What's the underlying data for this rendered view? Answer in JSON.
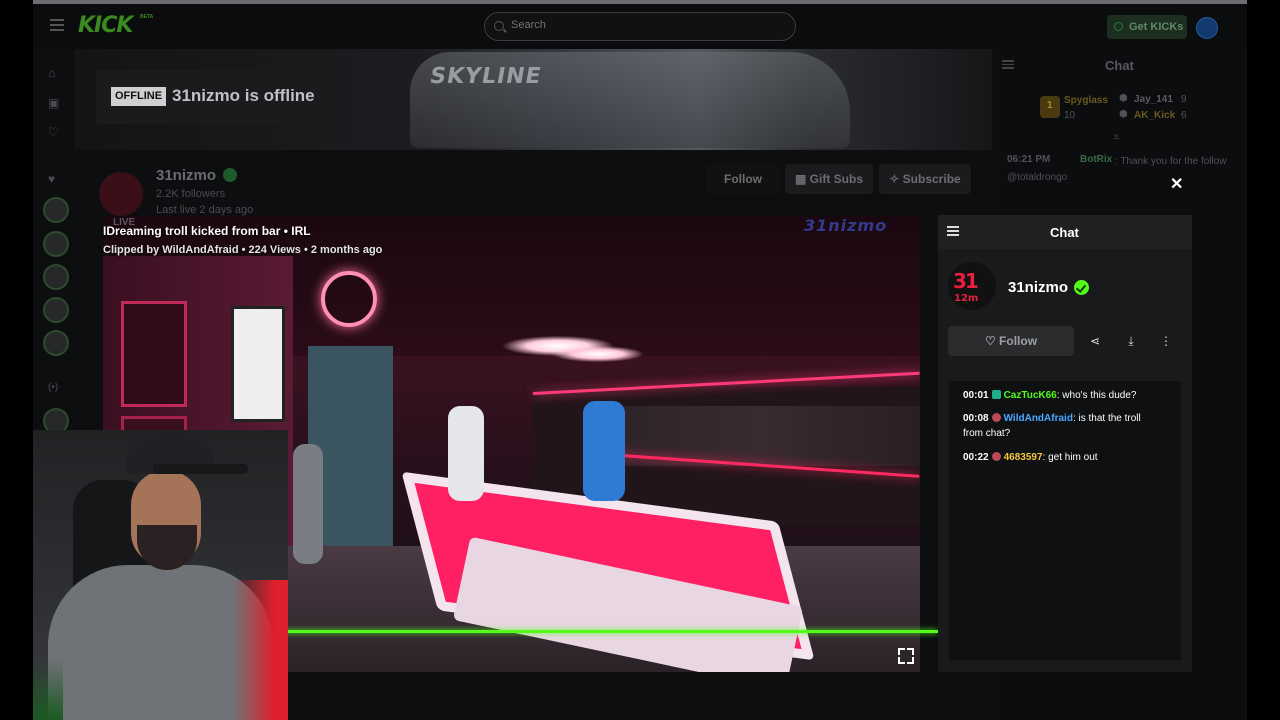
{
  "topnav": {
    "logo": "KICK",
    "logo_badge": "BETA",
    "search_placeholder": "Search",
    "get_kicks": "Get KICKs"
  },
  "banner": {
    "offline_badge": "OFFLINE",
    "offline_text": "31nizmo is offline",
    "car_text": "SKYLINE"
  },
  "channel": {
    "name": "31nizmo",
    "followers": "2.2K followers",
    "last_live": "Last live 2 days ago",
    "follow": "Follow",
    "gift_subs": "Gift Subs",
    "subscribe": "Subscribe"
  },
  "side_chat": {
    "title": "Chat",
    "leaderboard": [
      {
        "rank": "1",
        "name": "Spyglass",
        "count": "10"
      },
      {
        "rank": "",
        "name": "Jay_141",
        "count": "9"
      },
      {
        "rank": "",
        "name": "AK_Kick",
        "count": "6"
      }
    ],
    "message": {
      "time": "06:21 PM",
      "user": "BotRix",
      "text": ": Thank you for the follow @totaldrongo"
    }
  },
  "clip": {
    "title": "IDreaming troll kicked from bar • IRL",
    "meta": "Clipped by WildAndAfraid • 224 Views • 2 months ago",
    "live_tag": "LIVE",
    "watermark": "31nizmo",
    "progress": 1.0
  },
  "overlay_chat": {
    "title": "Chat",
    "channel_name": "31nizmo",
    "avatar_top": "31",
    "avatar_bottom": "12m",
    "follow": "Follow",
    "messages": [
      {
        "time": "00:01",
        "user": "CazTucK66",
        "user_color": "#53fc18",
        "badge_color": "#1fae8e",
        "text": ": who's this dude?"
      },
      {
        "time": "00:08",
        "user": "WildAndAfraid",
        "user_color": "#4aa8ff",
        "badge_color": "#b84a5a",
        "text": ": is that the troll from chat?"
      },
      {
        "time": "00:22",
        "user": "4683597",
        "user_color": "#f5c842",
        "badge_color": "#b84a5a",
        "text": ": get him out"
      }
    ]
  },
  "colors": {
    "accent": "#53fc18",
    "verify": "#53fc18"
  },
  "icons": [
    "menu-icon",
    "search-icon",
    "home-icon",
    "browse-icon",
    "heart-icon",
    "close-icon",
    "share-icon",
    "download-icon",
    "more-icon",
    "fullscreen-icon",
    "collapse-icon"
  ]
}
